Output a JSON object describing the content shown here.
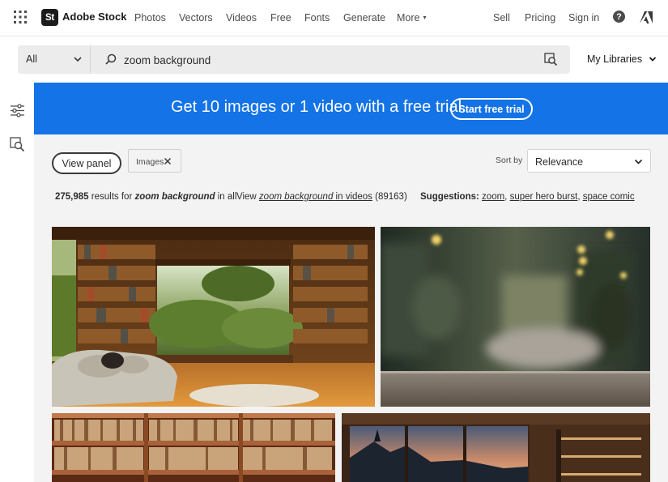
{
  "header": {
    "logo_mark": "St",
    "logo_text": "Adobe Stock",
    "nav": [
      "Photos",
      "Vectors",
      "Videos",
      "Free",
      "Fonts",
      "Generate",
      "More"
    ],
    "sell": "Sell",
    "pricing": "Pricing",
    "sign_in": "Sign in",
    "help_glyph": "?",
    "icons": [
      "apps-grid-icon",
      "help-icon",
      "adobe-logo-icon"
    ]
  },
  "search": {
    "scope": "All",
    "query": "zoom background",
    "icons": [
      "search-icon",
      "visual-search-icon"
    ]
  },
  "libraries": {
    "label": "My Libraries"
  },
  "banner": {
    "text": "Get 10 images or 1 video with a free trial.",
    "cta": "Start free trial",
    "color": "#1473e6"
  },
  "filters": {
    "view_panel": "View panel",
    "chip_label": "Images",
    "sort_label": "Sort by",
    "sort_value": "Relevance"
  },
  "results": {
    "count": "275,985",
    "prefix": "results for",
    "query": "zoom background",
    "suffix": "in all",
    "view_prefix": "View",
    "video_query": "zoom background",
    "video_suffix": "in videos",
    "video_count": "(89163)",
    "suggestions_label": "Suggestions:",
    "suggestions": [
      "zoom",
      "super hero burst",
      "space comic"
    ]
  },
  "thumbnails": [
    {
      "subject": "library room with window view"
    },
    {
      "subject": "blurred cafe with wooden table"
    },
    {
      "subject": "bookshelves of old books"
    },
    {
      "subject": "modern room with sunset window"
    }
  ]
}
